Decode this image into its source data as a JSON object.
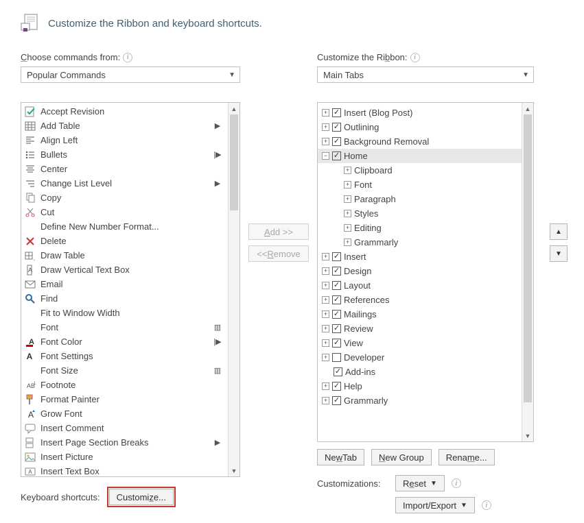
{
  "header": {
    "title": "Customize the Ribbon and keyboard shortcuts."
  },
  "left": {
    "label": "Choose commands from:",
    "combo": "Popular Commands",
    "commands": [
      {
        "label": "Accept Revision",
        "icon": "accept",
        "extra": ""
      },
      {
        "label": "Add Table",
        "icon": "table",
        "extra": "▶"
      },
      {
        "label": "Align Left",
        "icon": "alignleft",
        "extra": ""
      },
      {
        "label": "Bullets",
        "icon": "bullets",
        "extra": "|▶"
      },
      {
        "label": "Center",
        "icon": "center",
        "extra": ""
      },
      {
        "label": "Change List Level",
        "icon": "listlevel",
        "extra": "▶"
      },
      {
        "label": "Copy",
        "icon": "copy",
        "extra": ""
      },
      {
        "label": "Cut",
        "icon": "cut",
        "extra": ""
      },
      {
        "label": "Define New Number Format...",
        "icon": "",
        "extra": ""
      },
      {
        "label": "Delete",
        "icon": "delete",
        "extra": ""
      },
      {
        "label": "Draw Table",
        "icon": "drawtable",
        "extra": ""
      },
      {
        "label": "Draw Vertical Text Box",
        "icon": "vtext",
        "extra": ""
      },
      {
        "label": "Email",
        "icon": "email",
        "extra": ""
      },
      {
        "label": "Find",
        "icon": "find",
        "extra": ""
      },
      {
        "label": "Fit to Window Width",
        "icon": "",
        "extra": ""
      },
      {
        "label": "Font",
        "icon": "",
        "extra": "▥"
      },
      {
        "label": "Font Color",
        "icon": "fontcolor",
        "extra": "|▶"
      },
      {
        "label": "Font Settings",
        "icon": "fontsettings",
        "extra": ""
      },
      {
        "label": "Font Size",
        "icon": "",
        "extra": "▥"
      },
      {
        "label": "Footnote",
        "icon": "footnote",
        "extra": ""
      },
      {
        "label": "Format Painter",
        "icon": "painter",
        "extra": ""
      },
      {
        "label": "Grow Font",
        "icon": "growfont",
        "extra": ""
      },
      {
        "label": "Insert Comment",
        "icon": "comment",
        "extra": ""
      },
      {
        "label": "Insert Page  Section Breaks",
        "icon": "pagebreak",
        "extra": "▶"
      },
      {
        "label": "Insert Picture",
        "icon": "picture",
        "extra": ""
      },
      {
        "label": "Insert Text Box",
        "icon": "textbox",
        "extra": ""
      }
    ]
  },
  "mid": {
    "add": "Add >>",
    "remove": "<< Remove"
  },
  "right": {
    "label": "Customize the Ribbon:",
    "combo": "Main Tabs",
    "tree": [
      {
        "level": 0,
        "expand": "+",
        "checked": true,
        "label": "Insert (Blog Post)"
      },
      {
        "level": 0,
        "expand": "+",
        "checked": true,
        "label": "Outlining"
      },
      {
        "level": 0,
        "expand": "+",
        "checked": true,
        "label": "Background Removal"
      },
      {
        "level": 0,
        "expand": "-",
        "checked": true,
        "label": "Home",
        "sel": true
      },
      {
        "level": 1,
        "expand": "+",
        "checked": null,
        "label": "Clipboard"
      },
      {
        "level": 1,
        "expand": "+",
        "checked": null,
        "label": "Font"
      },
      {
        "level": 1,
        "expand": "+",
        "checked": null,
        "label": "Paragraph"
      },
      {
        "level": 1,
        "expand": "+",
        "checked": null,
        "label": "Styles"
      },
      {
        "level": 1,
        "expand": "+",
        "checked": null,
        "label": "Editing"
      },
      {
        "level": 1,
        "expand": "+",
        "checked": null,
        "label": "Grammarly"
      },
      {
        "level": 0,
        "expand": "+",
        "checked": true,
        "label": "Insert"
      },
      {
        "level": 0,
        "expand": "+",
        "checked": true,
        "label": "Design"
      },
      {
        "level": 0,
        "expand": "+",
        "checked": true,
        "label": "Layout"
      },
      {
        "level": 0,
        "expand": "+",
        "checked": true,
        "label": "References"
      },
      {
        "level": 0,
        "expand": "+",
        "checked": true,
        "label": "Mailings"
      },
      {
        "level": 0,
        "expand": "+",
        "checked": true,
        "label": "Review"
      },
      {
        "level": 0,
        "expand": "+",
        "checked": true,
        "label": "View"
      },
      {
        "level": 0,
        "expand": "+",
        "checked": false,
        "label": "Developer"
      },
      {
        "level": 0,
        "expand": "",
        "checked": true,
        "label": "Add-ins"
      },
      {
        "level": 0,
        "expand": "+",
        "checked": true,
        "label": "Help"
      },
      {
        "level": 0,
        "expand": "+",
        "checked": true,
        "label": "Grammarly"
      }
    ],
    "newtab": "New Tab",
    "newgroup": "New Group",
    "rename": "Rename...",
    "cust_label": "Customizations:",
    "reset": "Reset",
    "importexport": "Import/Export"
  },
  "kbd": {
    "label": "Keyboard shortcuts:",
    "button": "Customize..."
  }
}
